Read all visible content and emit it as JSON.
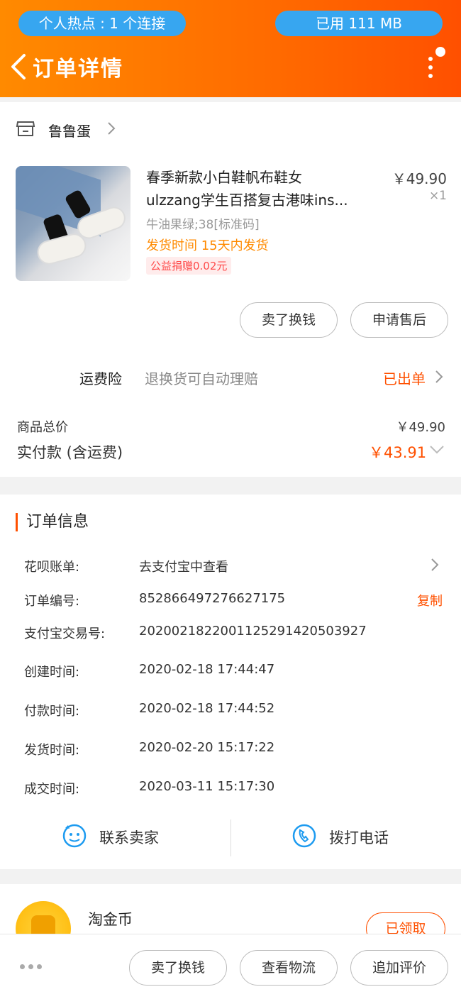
{
  "status_bar": {
    "hotspot": "个人热点 : 1 个连接",
    "data_used": "已用 111 MB"
  },
  "header": {
    "title": "订单详情"
  },
  "shop": {
    "name": "鲁鲁蛋"
  },
  "product": {
    "title_line1": "春季新款小白鞋帆布鞋女",
    "title_line2": "ulzzang学生百搭复古港味ins...",
    "price": "￥49.90",
    "quantity": "×1",
    "sku": "牛油果绿;38[标准码]",
    "ship_time": "发货时间 15天内发货",
    "charity": "公益捐赠0.02元"
  },
  "actions": {
    "sell": "卖了换钱",
    "after_sale": "申请售后"
  },
  "insurance": {
    "label": "运费险",
    "desc": "退换货可自动理赔",
    "status": "已出单"
  },
  "totals": {
    "goods_total_label": "商品总价",
    "goods_total": "￥49.90",
    "paid_label": "实付款 (含运费)",
    "paid": "￥43.91"
  },
  "order_info": {
    "title": "订单信息",
    "rows": [
      {
        "label": "花呗账单:",
        "value": "去支付宝中查看"
      },
      {
        "label": "订单编号:",
        "value": "852866497276627175"
      },
      {
        "label": "支付宝交易号:",
        "value": "2020021822001125291420503927"
      },
      {
        "label": "创建时间:",
        "value": "2020-02-18 17:44:47"
      },
      {
        "label": "付款时间:",
        "value": "2020-02-18 17:44:52"
      },
      {
        "label": "发货时间:",
        "value": "2020-02-20 15:17:22"
      },
      {
        "label": "成交时间:",
        "value": "2020-03-11 15:17:30"
      }
    ],
    "copy": "复制"
  },
  "contact": {
    "seller": "联系卖家",
    "call": "拨打电话"
  },
  "coins": {
    "label": "淘金币",
    "status": "已领取"
  },
  "bottom_bar": {
    "sell": "卖了换钱",
    "logistics": "查看物流",
    "review": "追加评价"
  },
  "colors": {
    "accent": "#ff5000",
    "header_start": "#ff8a00",
    "pill": "#37a6f0",
    "icon_blue": "#1d9bf0"
  },
  "icons": [
    "back-arrow-icon",
    "more-menu-icon",
    "shop-icon",
    "chevron-right-icon",
    "chevron-down-icon",
    "chat-icon",
    "phone-icon",
    "coin-icon",
    "more-dots-icon"
  ]
}
